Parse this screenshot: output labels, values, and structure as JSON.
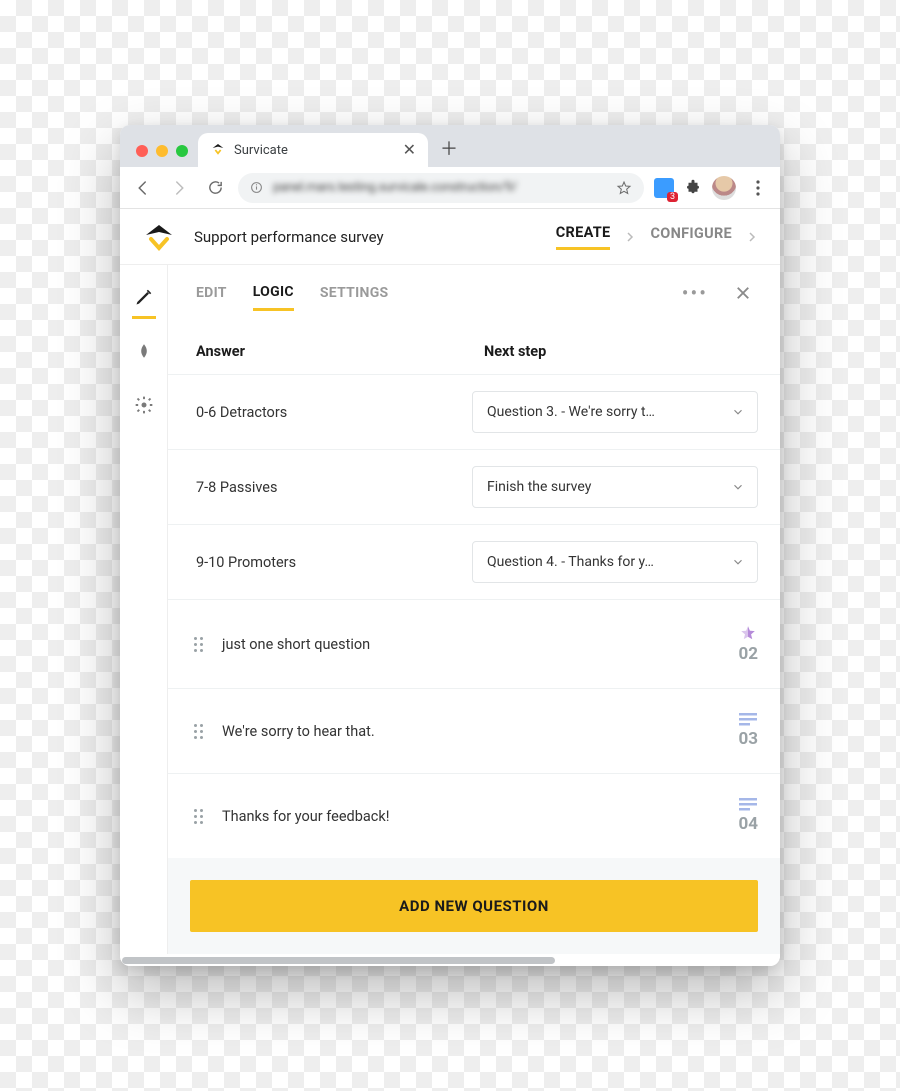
{
  "browser": {
    "tab_title": "Survicate",
    "url_blurred": "panel.mars.testing.survicale.construction/9/"
  },
  "header": {
    "survey_title": "Support performance survey",
    "steps": {
      "create": "CREATE",
      "configure": "CONFIGURE"
    }
  },
  "subtabs": {
    "edit": "EDIT",
    "logic": "LOGIC",
    "settings": "SETTINGS"
  },
  "table": {
    "head_answer": "Answer",
    "head_next": "Next step",
    "rows": [
      {
        "answer": "0-6 Detractors",
        "next": "Question 3. - We're sorry t…"
      },
      {
        "answer": "7-8 Passives",
        "next": "Finish the survey"
      },
      {
        "answer": "9-10 Promoters",
        "next": "Question 4. - Thanks for y…"
      }
    ]
  },
  "questions": [
    {
      "text": "just one short question",
      "num": "02",
      "icon": "star"
    },
    {
      "text": "We're sorry to hear that.",
      "num": "03",
      "icon": "lines"
    },
    {
      "text": "Thanks for your feedback!",
      "num": "04",
      "icon": "lines"
    }
  ],
  "add_button": "ADD NEW QUESTION"
}
